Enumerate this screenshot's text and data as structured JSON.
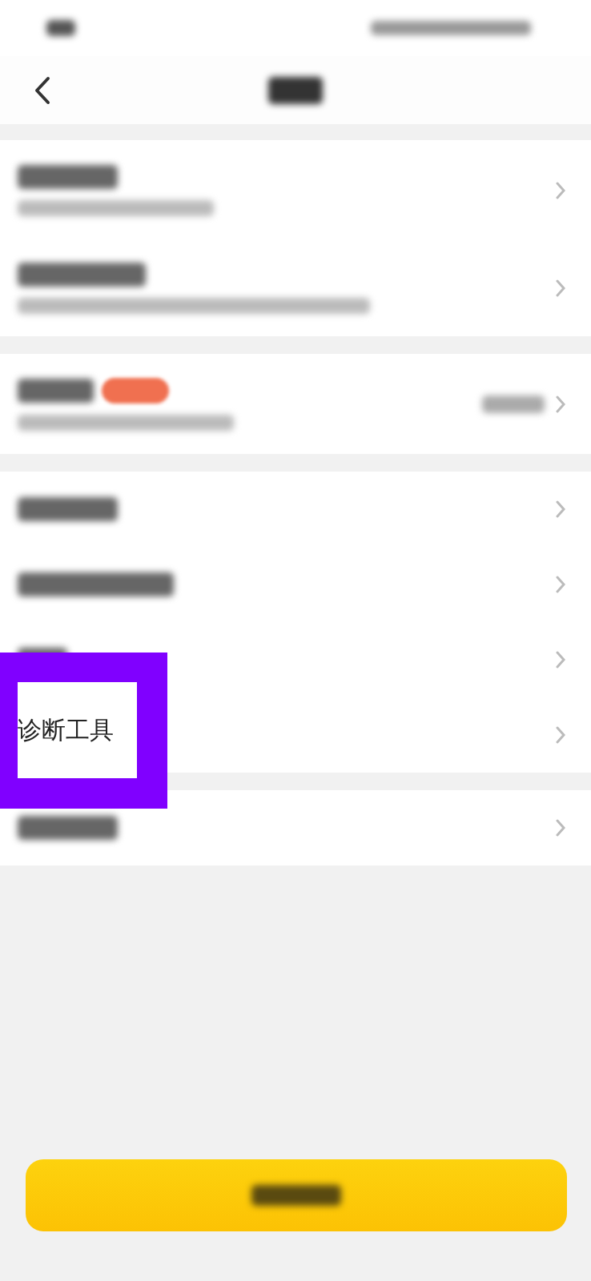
{
  "header": {
    "back": true
  },
  "groups": [
    {
      "rows": [
        {
          "kind": "two_line"
        },
        {
          "kind": "two_line_long"
        }
      ]
    },
    {
      "rows": [
        {
          "kind": "badge_value"
        }
      ]
    },
    {
      "rows": [
        {
          "kind": "one_line"
        },
        {
          "kind": "one_line_wide"
        },
        {
          "kind": "one_line_short"
        },
        {
          "kind": "empty"
        }
      ]
    },
    {
      "rows": [
        {
          "kind": "one_line"
        }
      ]
    }
  ],
  "highlight": {
    "label": "诊断工具"
  },
  "logout_button": {
    "kind": "primary"
  }
}
